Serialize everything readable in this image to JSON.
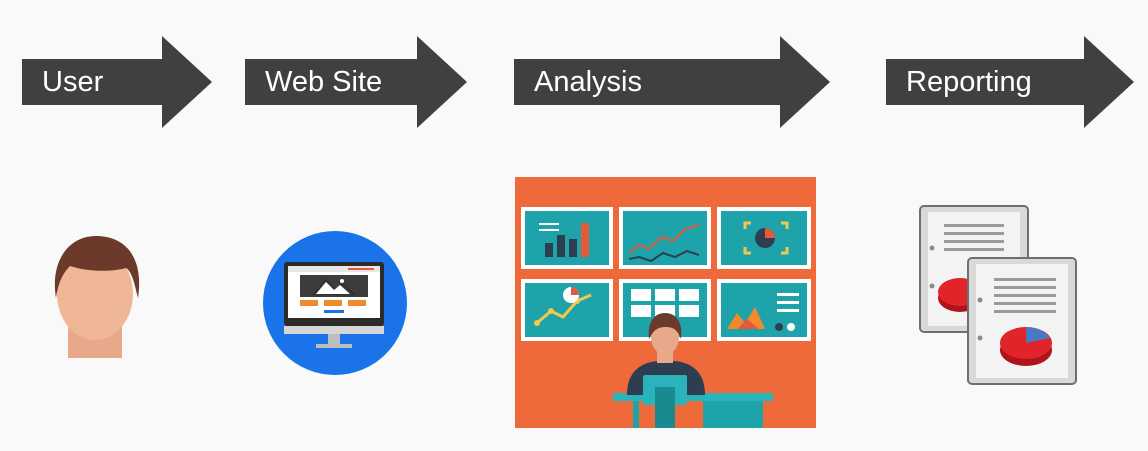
{
  "flow": {
    "steps": [
      {
        "label": "User",
        "icon": "user-avatar-icon"
      },
      {
        "label": "Web Site",
        "icon": "monitor-website-icon"
      },
      {
        "label": "Analysis",
        "icon": "analytics-dashboard-illustration"
      },
      {
        "label": "Reporting",
        "icon": "report-documents-icon"
      }
    ]
  },
  "colors": {
    "arrow": "#404040",
    "label": "#ffffff",
    "background": "#f9f9f9",
    "web_circle": "#1a73e8",
    "analysis_bg": "#ef6a3a",
    "analysis_panel": "#1fa3ab"
  }
}
